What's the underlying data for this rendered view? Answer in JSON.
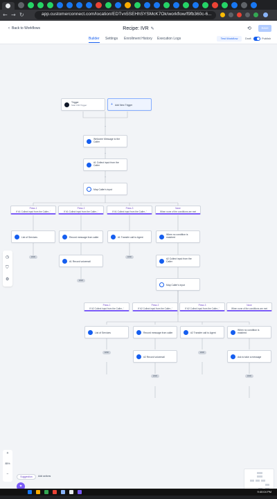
{
  "browser": {
    "url": "app.customerconnect.com/location/EDTvn5SEHhSYSMcK7Ok/workflow/f9fb360c-6..."
  },
  "header": {
    "back_label": "Back to Workflows",
    "title": "Recipe: IVR",
    "save_label": "Save",
    "tabs": [
      "Builder",
      "Settings",
      "Enrollment History",
      "Execution Logs"
    ],
    "active_tab": "Builder",
    "test_label": "Test Workflow",
    "draft_label": "Draft",
    "publish_label": "Publish",
    "publish_on": true
  },
  "nodes": {
    "trigger_title": "Trigger",
    "trigger_sub": "Start IVR Trigger",
    "add_trigger": "Add New Trigger",
    "welcome": "Welcome Message to the Caller",
    "collect1": "#1 Collect input from the Caller",
    "map1": "Map Caller's input",
    "branch1": [
      {
        "title": "Press 1",
        "desc": "If '#1 Collect input from the Caller...'"
      },
      {
        "title": "Press 2",
        "desc": "If '#1 Collect input from the Caller...'"
      },
      {
        "title": "Press 3",
        "desc": "If '#1 Collect input from the Caller...'"
      },
      {
        "title": "None",
        "desc": "When none of the conditions are met"
      }
    ],
    "b1_actions": [
      "List of Services",
      "Record message from caller",
      "#1 Transfer call to Agent",
      "When no condition is matched"
    ],
    "record1": "#1 Record voicemail",
    "collect2": "#2 Collect input from the Caller",
    "map2": "Map Caller's input",
    "branch2": [
      {
        "title": "Press 1",
        "desc": "If '#2 Collect input from the Caller...'"
      },
      {
        "title": "Press 2",
        "desc": "If '#2 Collect input from the Caller...'"
      },
      {
        "title": "Press 3",
        "desc": "If '#2 Collect input from the Caller...'"
      },
      {
        "title": "None",
        "desc": "When none of the conditions are met"
      }
    ],
    "b2_actions": [
      "List of Services",
      "Record message from caller",
      "#2 Transfer call to Agent",
      "When no condition is matched"
    ],
    "record2": "#2 Record voicemail",
    "leave_msg": "Ask to take a message",
    "end_label": "END"
  },
  "controls": {
    "zoom_in": "+",
    "zoom_level": "85%",
    "zoom_out": "−",
    "suggestion_label": "Suggestion",
    "add_actions_label": "Add actions",
    "clock": "9:40:04 PM"
  },
  "colors": {
    "accent": "#155eef",
    "branch": "#7a5af8"
  }
}
